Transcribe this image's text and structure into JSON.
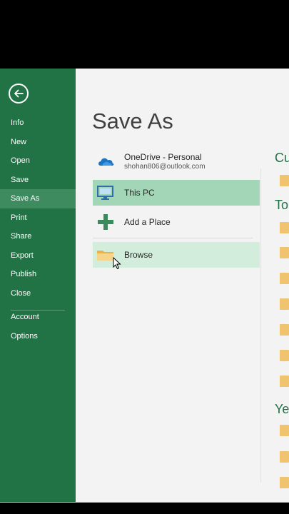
{
  "sidebar": {
    "back_label": "Back",
    "items": [
      {
        "label": "Info"
      },
      {
        "label": "New"
      },
      {
        "label": "Open"
      },
      {
        "label": "Save"
      },
      {
        "label": "Save As",
        "active": true
      },
      {
        "label": "Print"
      },
      {
        "label": "Share"
      },
      {
        "label": "Export"
      },
      {
        "label": "Publish"
      },
      {
        "label": "Close"
      }
    ],
    "bottom_items": [
      {
        "label": "Account"
      },
      {
        "label": "Options"
      }
    ]
  },
  "main": {
    "title": "Save As",
    "locations": [
      {
        "label": "OneDrive - Personal",
        "sublabel": "shohan806@outlook.com",
        "icon": "onedrive-cloud-icon"
      },
      {
        "label": "This PC",
        "icon": "computer-icon",
        "state": "selected"
      },
      {
        "label": "Add a Place",
        "icon": "plus-icon"
      },
      {
        "label": "Browse",
        "icon": "folder-icon",
        "state": "hover"
      }
    ]
  },
  "right_panel": {
    "headings": [
      "Cu",
      "To",
      "Yes"
    ]
  },
  "colors": {
    "accent": "#217346",
    "selected": "#a3d6b6",
    "hover": "#d2eddc",
    "folder": "#f0c46e"
  }
}
